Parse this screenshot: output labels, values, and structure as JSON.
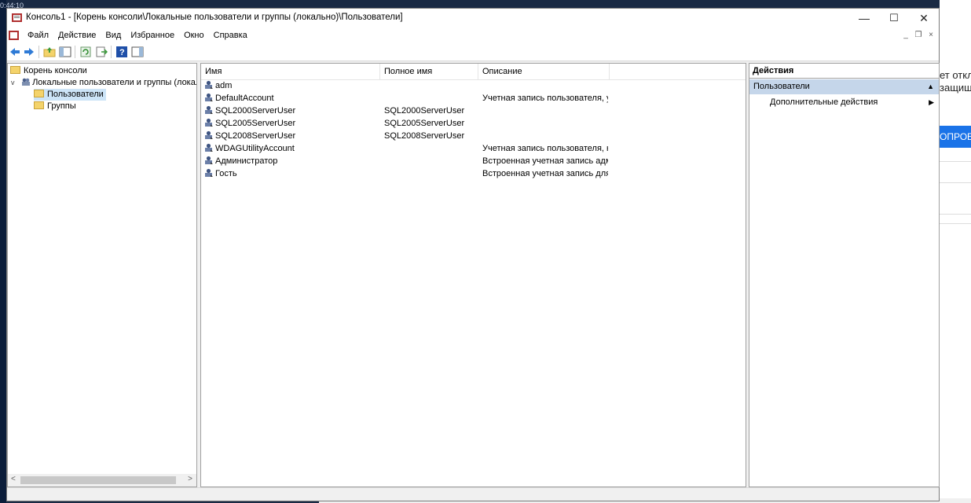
{
  "window": {
    "title": "Консоль1 - [Корень консоли\\Локальные пользователи и группы (локально)\\Пользователи]",
    "minimize": "—",
    "maximize": "☐",
    "close": "✕"
  },
  "menu": {
    "items": [
      "Файл",
      "Действие",
      "Вид",
      "Избранное",
      "Окно",
      "Справка"
    ],
    "mdi_minimize": "_",
    "mdi_restore": "❐",
    "mdi_close": "×"
  },
  "tree": {
    "root": "Корень консоли",
    "snapin": "Локальные пользователи и группы (локально)",
    "users": "Пользователи",
    "groups": "Группы",
    "expander": "v"
  },
  "list": {
    "columns": [
      "Имя",
      "Полное имя",
      "Описание"
    ],
    "rows": [
      {
        "name": "adm",
        "full_name": "",
        "description": ""
      },
      {
        "name": "DefaultAccount",
        "full_name": "",
        "description": "Учетная запись пользователя, у..."
      },
      {
        "name": "SQL2000ServerUser",
        "full_name": "SQL2000ServerUser",
        "description": ""
      },
      {
        "name": "SQL2005ServerUser",
        "full_name": "SQL2005ServerUser",
        "description": ""
      },
      {
        "name": "SQL2008ServerUser",
        "full_name": "SQL2008ServerUser",
        "description": ""
      },
      {
        "name": "WDAGUtilityAccount",
        "full_name": "",
        "description": "Учетная запись пользователя, к..."
      },
      {
        "name": "Администратор",
        "full_name": "",
        "description": "Встроенная учетная запись адм..."
      },
      {
        "name": "Гость",
        "full_name": "",
        "description": "Встроенная учетная запись для ..."
      }
    ]
  },
  "actions": {
    "header": "Действия",
    "section": "Пользователи",
    "more": "Дополнительные действия"
  },
  "background": {
    "text1": "ет откл",
    "text2": "защищ",
    "button": "ОПРОБ",
    "clock": "0:44:10"
  },
  "colors": {
    "selected_section": "#c5d6ea",
    "folder": "#f4d36b"
  }
}
